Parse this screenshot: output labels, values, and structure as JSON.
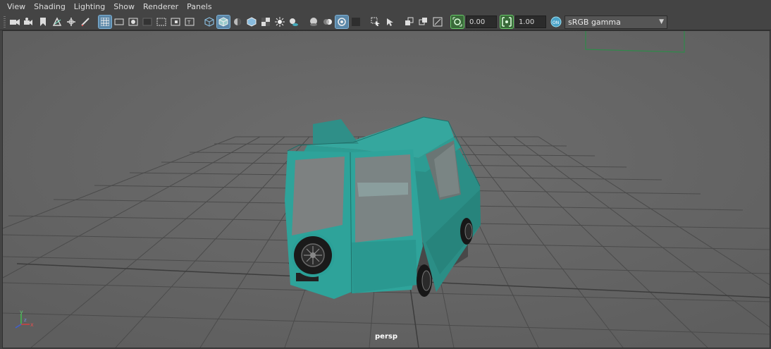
{
  "menu": {
    "items": [
      {
        "label": "View"
      },
      {
        "label": "Shading"
      },
      {
        "label": "Lighting"
      },
      {
        "label": "Show"
      },
      {
        "label": "Renderer"
      },
      {
        "label": "Panels"
      }
    ]
  },
  "toolbar": {
    "exposure_value": "0.00",
    "gamma_value": "1.00",
    "color_space": "sRGB gamma",
    "icons": [
      "camera-icon",
      "camera-attributes-icon",
      "bookmark-icon",
      "image-plane-icon",
      "2d-pan-zoom-icon",
      "grease-pencil-icon",
      "grid-icon",
      "film-gate-icon",
      "resolution-gate-icon",
      "gate-mask-icon",
      "field-chart-icon",
      "safe-action-icon",
      "safe-title-icon",
      "wireframe-icon",
      "smooth-shade-icon",
      "use-default-material-icon",
      "wireframe-on-shaded-icon",
      "textured-icon",
      "use-all-lights-icon",
      "shadows-icon",
      "screen-space-ao-icon",
      "motion-blur-icon",
      "multisample-aa-icon",
      "depth-of-field-icon",
      "isolate-select-icon",
      "xray-icon",
      "xray-active-components-icon",
      "xray-joints-icon",
      "exposure-icon",
      "gamma-icon",
      "color-management-icon"
    ]
  },
  "viewport": {
    "camera_label": "persp",
    "background_color": "#6a6a6a",
    "grid_color": "#4a4a4a",
    "model_color": "#2f9a92"
  },
  "axis_indicator": {
    "x": "x",
    "y": "y",
    "z": "z"
  }
}
